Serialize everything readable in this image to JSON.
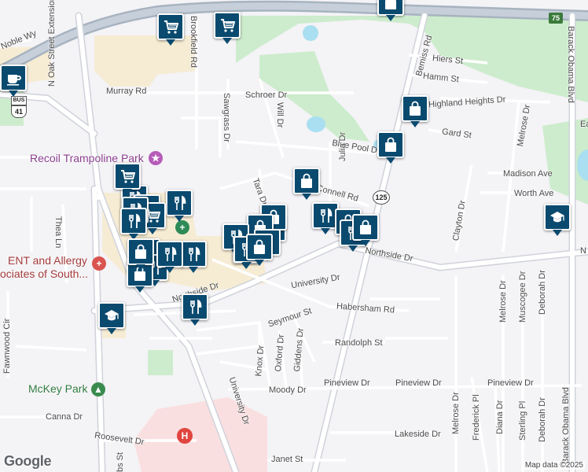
{
  "map": {
    "streets": [
      {
        "text": "Noble Wy"
      },
      {
        "text": "Murray Rd"
      },
      {
        "text": "N Oak Street Extension"
      },
      {
        "text": "Brookfield Rd"
      },
      {
        "text": "Schroer Dr"
      },
      {
        "text": "Sawgrass Dr"
      },
      {
        "text": "Will Dr"
      },
      {
        "text": "Blue Pool Dr"
      },
      {
        "text": "Julia Dr"
      },
      {
        "text": "Tara Dr"
      },
      {
        "text": "Connell Rd"
      },
      {
        "text": "Bemiss Rd"
      },
      {
        "text": "Hiers St"
      },
      {
        "text": "Hamm St"
      },
      {
        "text": "Highland Heights Dr"
      },
      {
        "text": "Gard St"
      },
      {
        "text": "Melrose Dr"
      },
      {
        "text": "Madison Ave"
      },
      {
        "text": "Worth Ave"
      },
      {
        "text": "Clayton Dr"
      },
      {
        "text": "Barack Obama Blvd"
      },
      {
        "text": "Northside Dr"
      },
      {
        "text": "N"
      },
      {
        "text": "Thea Ln"
      },
      {
        "text": "University Dr"
      },
      {
        "text": "Northside Dr"
      },
      {
        "text": "Seymour St"
      },
      {
        "text": "Habersham Rd"
      },
      {
        "text": "Randolph St"
      },
      {
        "text": "Giddens Dr"
      },
      {
        "text": "Oxford Dr"
      },
      {
        "text": "Knox Dr"
      },
      {
        "text": "Fawnwood Cir"
      },
      {
        "text": "Moody Dr"
      },
      {
        "text": "Pineview Dr"
      },
      {
        "text": "Pineview Dr"
      },
      {
        "text": "Pineview Dr"
      },
      {
        "text": "Melrose Dr"
      },
      {
        "text": "Muscogee Dr"
      },
      {
        "text": "Deborah Dr"
      },
      {
        "text": "Barack Obama Blvd"
      },
      {
        "text": "University Dr"
      },
      {
        "text": "Canna Dr"
      },
      {
        "text": "Roosevelt Dr"
      },
      {
        "text": "Lakeside Dr"
      },
      {
        "text": "Melrose Dr"
      },
      {
        "text": "Frederick Pl"
      },
      {
        "text": "Diana Dr"
      },
      {
        "text": "Sterling Pl"
      },
      {
        "text": "Deborah Dr"
      },
      {
        "text": "Janet St"
      },
      {
        "text": "Ea"
      },
      {
        "text": "bs St"
      }
    ],
    "places": [
      {
        "text": "Recoil Trampoline Park",
        "kind": "play"
      },
      {
        "text": "ENT and Allergy",
        "kind": "medical"
      },
      {
        "text": "ociates of South...",
        "kind": "medical"
      },
      {
        "text": "McKey Park",
        "kind": "park"
      }
    ],
    "shields": [
      {
        "text": "75"
      },
      {
        "text": "125"
      },
      {
        "text": "BUS"
      },
      {
        "text": "41"
      }
    ],
    "pins": [
      {
        "icon": "cart-icon"
      },
      {
        "icon": "cart-icon"
      },
      {
        "icon": "coffee-icon"
      },
      {
        "icon": "bag-icon"
      },
      {
        "icon": "bag-icon"
      },
      {
        "icon": "bag-icon"
      },
      {
        "icon": "school-icon"
      },
      {
        "icon": "cart-icon"
      },
      {
        "icon": "bag-icon"
      },
      {
        "icon": "fork-knife-icon"
      },
      {
        "icon": "cart-icon"
      },
      {
        "icon": "fork-knife-icon"
      },
      {
        "icon": "fork-knife-icon"
      },
      {
        "icon": "bag-icon"
      },
      {
        "icon": "bag-icon"
      },
      {
        "icon": "fork-knife-icon"
      },
      {
        "icon": "bag-icon"
      },
      {
        "icon": "fork-knife-icon"
      },
      {
        "icon": "bag-icon"
      },
      {
        "icon": "fork-knife-icon"
      },
      {
        "icon": "bag-icon"
      },
      {
        "icon": "fork-knife-icon"
      },
      {
        "icon": "bag-icon"
      },
      {
        "icon": "fork-knife-icon"
      },
      {
        "icon": "bag-icon"
      },
      {
        "icon": "school-icon"
      },
      {
        "icon": "fork-knife-icon"
      },
      {
        "icon": "fork-knife-icon"
      }
    ],
    "attribution": "Map data ©2025",
    "logo": "Google",
    "colors": {
      "pin": "#0b4a6f",
      "park": "#cdeccd",
      "water": "#a9dff0",
      "highway": "#a7b3c0",
      "commercial": "#f6ecd4",
      "hospital_area": "#fadfe0",
      "road": "#ffffff",
      "road_outline": "#cfd3da"
    }
  }
}
